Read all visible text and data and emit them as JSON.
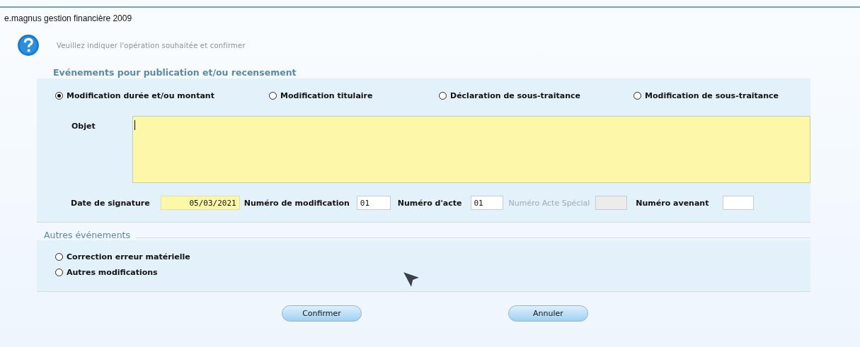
{
  "window": {
    "title": "e.magnus gestion financière 2009"
  },
  "prompt": "Veuillez indiquer l'opération souhaitée et confirmer",
  "publication_section": {
    "title": "Evénements pour publication et/ou recensement",
    "options": [
      {
        "label": "Modification durée et/ou montant",
        "selected": true
      },
      {
        "label": "Modification titulaire",
        "selected": false
      },
      {
        "label": "Déclaration de sous-traitance",
        "selected": false
      },
      {
        "label": "Modification de sous-traitance",
        "selected": false
      }
    ],
    "objet": {
      "label": "Objet",
      "highlighted": true,
      "focused": true
    },
    "fields": [
      {
        "label": "Date de signature",
        "value": "05/03/2021",
        "highlighted": true,
        "disabled": false,
        "kind": "date"
      },
      {
        "label": "Numéro de modification",
        "value": "01",
        "highlighted": false,
        "disabled": false,
        "kind": "number"
      },
      {
        "label": "Numéro d'acte",
        "value": "01",
        "highlighted": false,
        "disabled": false,
        "kind": "number"
      },
      {
        "label": "Numéro Acte Spécial",
        "highlighted": false,
        "disabled": true,
        "kind": "number"
      },
      {
        "label": "Numéro avenant",
        "highlighted": false,
        "disabled": false,
        "kind": "number"
      }
    ]
  },
  "other_section": {
    "title": "Autres événements",
    "options": [
      {
        "label": "Correction erreur matérielle",
        "selected": false
      },
      {
        "label": "Autres modifications",
        "selected": false
      }
    ]
  },
  "buttons": [
    {
      "label": "Confirmer"
    },
    {
      "label": "Annuler"
    }
  ]
}
